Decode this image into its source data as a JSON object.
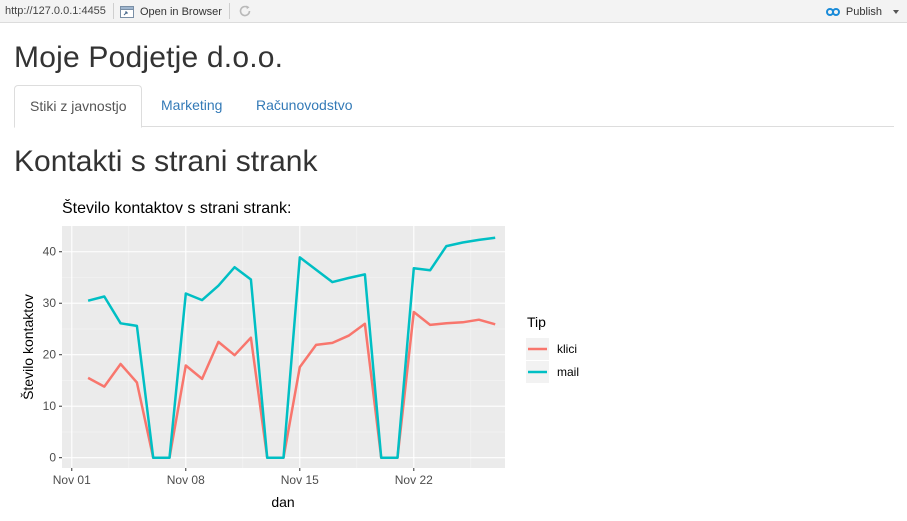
{
  "toolbar": {
    "url": "http://127.0.0.1:4455",
    "open_in_browser_label": "Open in Browser",
    "publish_label": "Publish",
    "icons": [
      "browser-icon",
      "refresh-icon",
      "publish-icon",
      "chevron-down-icon"
    ]
  },
  "app": {
    "title": "Moje Podjetje d.o.o."
  },
  "tabs": [
    {
      "label": "Stiki z javnostjo",
      "active": true
    },
    {
      "label": "Marketing",
      "active": false
    },
    {
      "label": "Računovodstvo",
      "active": false
    }
  ],
  "section": {
    "title": "Kontakti s strani strank"
  },
  "colors": {
    "klici": "#F8766D",
    "mail": "#00BFC4",
    "panel_bg": "#EBEBEB",
    "tab_link": "#337ab7"
  },
  "chart_data": {
    "type": "line",
    "title": "Število kontaktov s strani strank:",
    "xlabel": "dan",
    "ylabel": "Število kontaktov",
    "x_tick_labels": [
      "Nov 01",
      "Nov 08",
      "Nov 15",
      "Nov 22"
    ],
    "x_tick_days": [
      1,
      8,
      15,
      22
    ],
    "y_ticks": [
      0,
      10,
      20,
      30,
      40
    ],
    "xlim": [
      0.4,
      27.6
    ],
    "ylim": [
      -2.0,
      45.0
    ],
    "grid": true,
    "legend_title": "Tip",
    "legend_position": "right",
    "x": [
      2,
      3,
      4,
      5,
      6,
      7,
      8,
      9,
      10,
      11,
      12,
      13,
      14,
      15,
      16,
      17,
      18,
      19,
      20,
      21,
      22,
      23,
      24,
      25,
      26,
      27
    ],
    "series": [
      {
        "name": "klici",
        "values": [
          15.5,
          13.8,
          18.2,
          14.6,
          0,
          0,
          17.9,
          15.3,
          22.5,
          19.9,
          23.3,
          0,
          0,
          17.6,
          21.9,
          22.3,
          23.7,
          26.0,
          0,
          0,
          28.3,
          25.8,
          26.1,
          26.3,
          26.8,
          25.9
        ]
      },
      {
        "name": "mail",
        "values": [
          30.5,
          31.3,
          26.1,
          25.6,
          0,
          0,
          31.9,
          30.6,
          33.4,
          37.0,
          34.6,
          0,
          0,
          38.9,
          36.5,
          34.1,
          34.9,
          35.6,
          0,
          0,
          36.8,
          36.4,
          41.1,
          41.8,
          42.3,
          42.7
        ]
      }
    ]
  }
}
